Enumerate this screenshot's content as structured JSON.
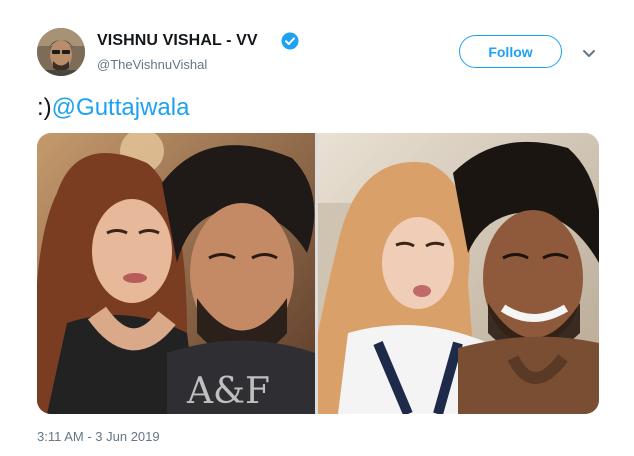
{
  "tweet": {
    "display_name": "VISHNU VISHAL - VV",
    "handle": "@TheVishnuVishal",
    "follow_label": "Follow",
    "text_prefix": ":)",
    "mention": "@Guttajwala",
    "timestamp": "3:11 AM - 3 Jun 2019"
  },
  "icons": {
    "verified": "verified-badge-icon",
    "more": "chevron-down-icon"
  },
  "colors": {
    "accent": "#1da1f2",
    "secondary_text": "#657786",
    "primary_text": "#14171a"
  }
}
